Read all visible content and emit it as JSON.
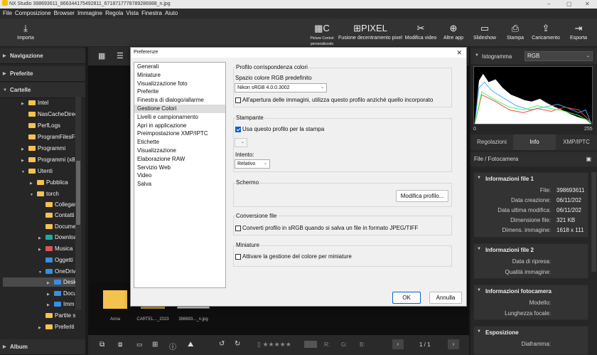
{
  "window": {
    "title": "NX Studio    398693611_866344175492811_6718717778789286988_n.jpg"
  },
  "menu": [
    "File",
    "Composizione",
    "Browser",
    "Immagine",
    "Regola",
    "Vista",
    "Finestra",
    "Aiuto"
  ],
  "toolbar": {
    "import": "Importa",
    "pixel_shift_caption": "Picture Control personalizzato",
    "fusion": "Fusione decentramento pixel",
    "video": "Modifica video",
    "other_apps": "Altre app",
    "slideshow": "Slideshow",
    "print": "Stampa",
    "upload": "Caricamento",
    "export": "Esporta"
  },
  "left": {
    "navigation": "Navigazione",
    "favorites": "Preferite",
    "folders": "Cartelle",
    "album": "Album",
    "tree": [
      "Intel",
      "NasCacheDirec",
      "PerfLogs",
      "ProgramFilesFo",
      "Programmi",
      "Programmi (x86",
      "Utenti",
      "Pubblica",
      "torch",
      "Collegar",
      "Contatti",
      "Docume",
      "Downloa",
      "Musica",
      "Oggetti",
      "OneDriv",
      "Desk",
      "Docu",
      "Imm",
      "Partite s",
      "Preferiti"
    ]
  },
  "center": {
    "thumbs": [
      "Anna",
      "CARTEL..._2023",
      "398693..._n.jpg"
    ],
    "page": "1 / 1",
    "r_label": "R:",
    "g_label": "G:",
    "b_label": "B:"
  },
  "right": {
    "histogram_label": "Istogramma",
    "channel": "RGB",
    "hist_min": "0",
    "hist_max": "255",
    "tabs": [
      "Regolazioni",
      "Info",
      "XMP/IPTC"
    ],
    "file_camera": "File / Fotocamera",
    "info1": {
      "title": "Informazioni file 1",
      "rows": [
        [
          "File:",
          "398693611"
        ],
        [
          "Data creazione:",
          "06/11/202"
        ],
        [
          "Data ultima modifica:",
          "06/11/202"
        ],
        [
          "Dimensione file:",
          "321 KB"
        ],
        [
          "Dimens. immagine:",
          "1618 x 111"
        ]
      ]
    },
    "info2": {
      "title": "Informazioni file 2",
      "rows": [
        [
          "Data di ripresa:",
          ""
        ],
        [
          "Qualità immagine:",
          ""
        ]
      ]
    },
    "info3": {
      "title": "Informazioni fotocamera",
      "rows": [
        [
          "Modello:",
          ""
        ],
        [
          "Lunghezza focale:",
          ""
        ]
      ]
    },
    "info4": {
      "title": "Esposizione",
      "rows": [
        [
          "Diaframma:",
          ""
        ]
      ]
    }
  },
  "dialog": {
    "title": "Preferenze",
    "nav": [
      "Generali",
      "Miniature",
      "Visualizzazione foto",
      "Preferite",
      "Finestra di dialogo/allarme",
      "Gestione Colori",
      "Livelli e campionamento",
      "Apri in applicazione",
      "Preimpostazione XMP/IPTC",
      "Etichette",
      "Visualizzazione",
      "Elaborazione RAW",
      "Servizio Web",
      "Video",
      "Salva"
    ],
    "profile_section": "Profilo corrispondenza colori",
    "rgb_space_label": "Spazio colore RGB predefinito",
    "rgb_space_value": "Nikon sRGB 4.0.0.3002",
    "open_use_profile": "All'apertura delle immagini, utilizza questo profilo anziché quello incorporato",
    "print_section": "Stampante",
    "use_profile_print": "Usa questo profilo per la stampa",
    "intent_label": "Intento:",
    "intent_value": "Relativo",
    "screen_section": "Schermo",
    "modify_profile": "Modifica profilo...",
    "convert_section": "Conversione file",
    "convert_srgb": "Converti profilo in sRGB quando si salva un file in formato JPEG/TIFF",
    "thumb_section": "Miniature",
    "thumb_color": "Attivare la gestione del colore per miniature",
    "ok": "OK",
    "cancel": "Annulla"
  }
}
